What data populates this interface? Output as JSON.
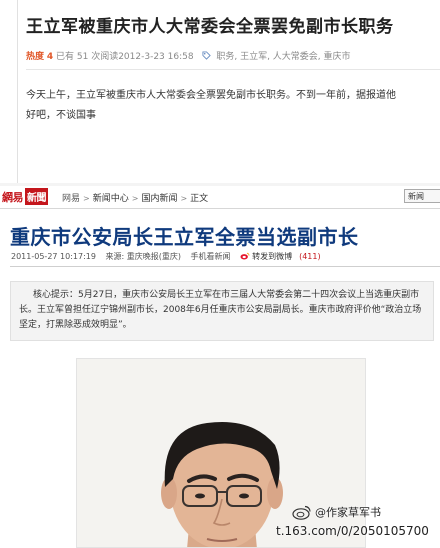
{
  "post": {
    "title": "王立军被重庆市人大常委会全票罢免副市长职务",
    "heat_label": "热度",
    "heat_value": "4",
    "meta_text": "已有 51 次阅读2012-3-23 16:58",
    "tags": "职务, 王立军, 人大常委会, 重庆市",
    "body_lines": [
      "今天上午，王立军被重庆市人大常委会全票罢免副市长职务。不到一年前，据报道他",
      "好吧，不谈国事"
    ]
  },
  "nav": {
    "logo_part1": "網易",
    "logo_part2": "新聞",
    "crumbs": [
      "网易",
      "新闻中心",
      "国内新闻",
      "正文"
    ],
    "select_value": "新闻"
  },
  "article": {
    "title": "重庆市公安局长王立军全票当选副市长",
    "datetime": "2011-05-27 10:17:19",
    "source": "来源: 重庆晚报(重庆)",
    "mobile": "手机看新闻",
    "weibo_label": "转发到微博",
    "weibo_count": "(411)",
    "summary": "核心提示：5月27日，重庆市公安局长王立军在市三届人大常委会第二十四次会议上当选重庆副市长。王立军曾担任辽宁锦州副市长，2008年6月任重庆市公安局副局长。重庆市政府评价他“政治立场坚定，打黑除恶成效明显”。"
  },
  "watermark": {
    "line1": "@作家草军书",
    "line2": "t.163.com/0/2050105700"
  },
  "colors": {
    "heat": "#e1582a",
    "brand_red": "#c4161c",
    "title_blue": "#0f3a7d"
  },
  "icons": [
    "tag-icon",
    "weibo-icon",
    "weibo-watermark-icon"
  ]
}
